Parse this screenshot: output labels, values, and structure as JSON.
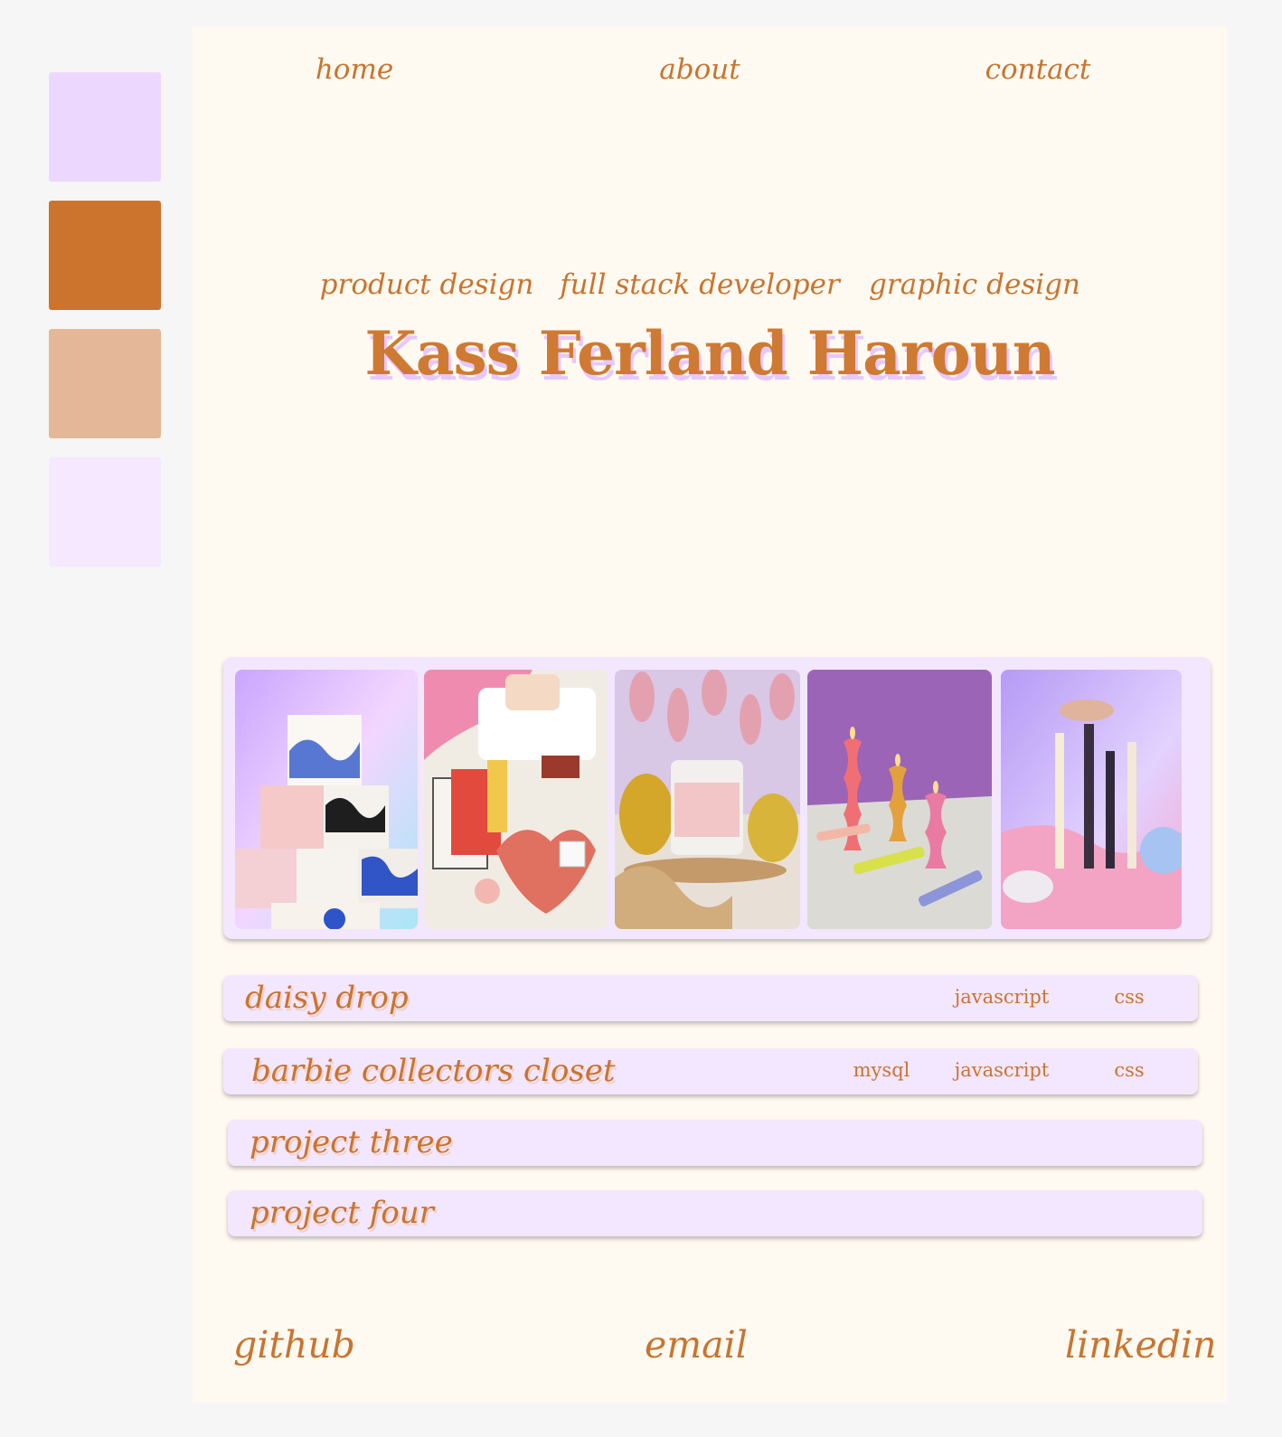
{
  "palette": {
    "swatches": [
      "#ecd8ff",
      "#cc742e",
      "#e3b797",
      "#f5e8ff"
    ],
    "page_background": "#fffaf1",
    "accent_text": "#c9742f",
    "card_background": "#f3e6ff"
  },
  "nav": {
    "home": "home",
    "about": "about",
    "contact": "contact"
  },
  "hero": {
    "roles": [
      "product design",
      "full stack developer",
      "graphic design"
    ],
    "name": "Kass Ferland Haroun"
  },
  "gallery": {
    "photos": [
      {
        "icon": "photo-stacked-boxes"
      },
      {
        "icon": "photo-tarot-cards-bath-bomb"
      },
      {
        "icon": "photo-candle-jar-pears"
      },
      {
        "icon": "photo-wavy-candles"
      },
      {
        "icon": "photo-taper-candles"
      }
    ]
  },
  "projects": [
    {
      "title": "daisy drop",
      "tags": [
        "javascript",
        "css"
      ]
    },
    {
      "title": "barbie collectors closet",
      "tags": [
        "mysql",
        "javascript",
        "css"
      ]
    },
    {
      "title": "project three",
      "tags": []
    },
    {
      "title": "project four",
      "tags": []
    }
  ],
  "footer": {
    "github": "github",
    "email": "email",
    "linkedin": "linkedin"
  }
}
